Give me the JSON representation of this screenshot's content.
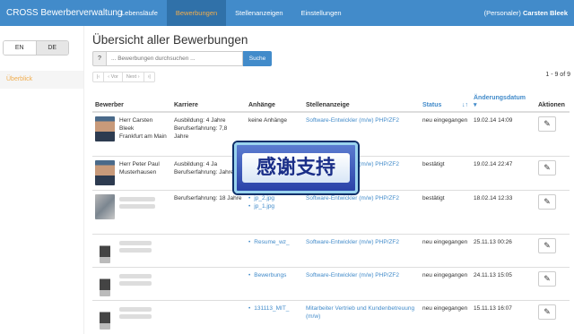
{
  "navbar": {
    "brand": "CROSS Bewerberverwaltung",
    "items": [
      {
        "label": "Lebensläufe",
        "active": false
      },
      {
        "label": "Bewerbungen",
        "active": true
      },
      {
        "label": "Stellenanzeigen",
        "active": false
      },
      {
        "label": "Einstellungen",
        "active": false
      }
    ],
    "user_role": "(Personaler)",
    "user_name": "Carsten Bleek"
  },
  "sidebar": {
    "lang_en": "EN",
    "lang_de": "DE",
    "overview_link": "Überblick"
  },
  "main": {
    "title": "Übersicht aller Bewerbungen",
    "search": {
      "help": "?",
      "placeholder": "... Bewerbungen durchsuchen ...",
      "button": "Suche"
    },
    "pager": {
      "first": "|‹",
      "prev": "‹ Vor",
      "next": "Next ›",
      "last": "›|"
    },
    "count": "1 - 9 of 9",
    "columns": {
      "bewerber": "Bewerber",
      "karriere": "Karriere",
      "anhaenge": "Anhänge",
      "stellenanzeige": "Stellenanzeige",
      "status": "Status",
      "status_sort_icon": "↓↑",
      "aenderungsdatum": "Änderungsdatum",
      "aenderungsdatum_sort_icon": "▾",
      "aktionen": "Aktionen"
    },
    "rows": [
      {
        "name": "Herr Carsten Bleek",
        "location": "Frankfurt am Main",
        "karriere": "Ausbildung: 4 Jahre Berufserfahrung: 7,8 Jahre",
        "anhaenge": "keine Anhänge",
        "attachments": [],
        "stelle": "Software-Entwickler (m/w) PHP/ZF2",
        "status": "neu eingegangen",
        "datum": "19.02.14 14:09",
        "edit_icon": "✎"
      },
      {
        "name": "Herr Peter Paul Musterhausen",
        "location": "",
        "karriere": "Ausbildung: 4 Ja Berufserfahrung: Jahre",
        "anhaenge": "",
        "attachments": [],
        "stelle": "Software-Entwickler (m/w) PHP/ZF2",
        "status": "bestätigt",
        "datum": "19.02.14 22:47",
        "edit_icon": "✎"
      },
      {
        "name": "",
        "location": "",
        "karriere": "Berufserfahrung: 18 Jahre",
        "anhaenge": "",
        "attachments": [
          "jp_2.jpg",
          "jp_1.jpg"
        ],
        "stelle": "Software-Entwickler (m/w) PHP/ZF2",
        "status": "bestätigt",
        "datum": "18.02.14 12:33",
        "edit_icon": "✎"
      },
      {
        "name": "",
        "location": "",
        "karriere": "",
        "anhaenge": "",
        "attachments": [
          "Resume_wz_"
        ],
        "stelle": "Software-Entwickler (m/w) PHP/ZF2",
        "status": "neu eingegangen",
        "datum": "25.11.13 00:26",
        "edit_icon": "✎"
      },
      {
        "name": "",
        "location": "",
        "karriere": "",
        "anhaenge": "",
        "attachments": [
          "Bewerbungs"
        ],
        "stelle": "Software-Entwickler (m/w) PHP/ZF2",
        "status": "neu eingegangen",
        "datum": "24.11.13 15:05",
        "edit_icon": "✎"
      },
      {
        "name": "",
        "location": "",
        "karriere": "",
        "anhaenge": "",
        "attachments": [
          "131113_MIT_"
        ],
        "stelle": "Mitarbeiter Vertrieb und Kundenbetreuung (m/w)",
        "status": "neu eingegangen",
        "datum": "15.11.13 16:07",
        "edit_icon": "✎"
      }
    ]
  },
  "overlay": {
    "text": "感谢支持"
  }
}
